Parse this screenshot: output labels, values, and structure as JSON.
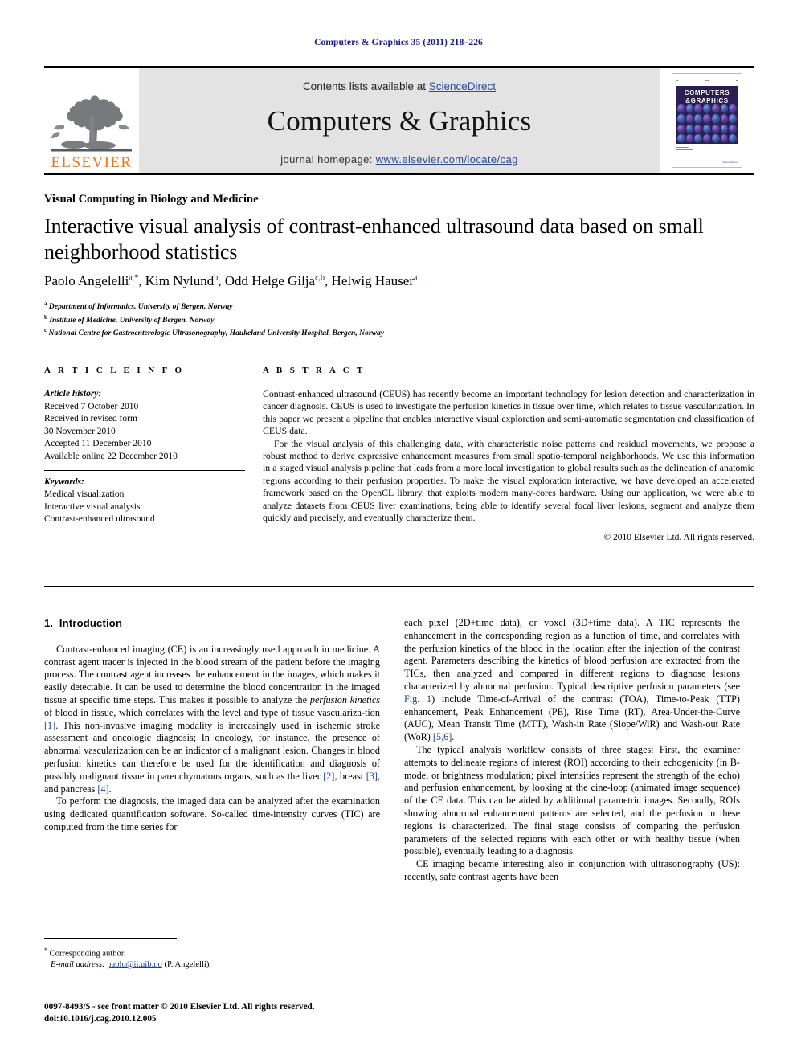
{
  "running_head": "Computers & Graphics 35 (2011) 218–226",
  "masthead": {
    "publisher_name": "ELSEVIER",
    "contents_prefix": "Contents lists available at ",
    "contents_link": "ScienceDirect",
    "journal_title": "Computers & Graphics",
    "homepage_label": "journal homepage: ",
    "homepage_url": "www.elsevier.com/locate/cag",
    "cover": {
      "title_line1": "COMPUTERS",
      "title_line2": "&GRAPHICS",
      "sciencedirect": "ScienceDirect"
    }
  },
  "section_marker": "Visual Computing in Biology and Medicine",
  "title": "Interactive visual analysis of contrast-enhanced ultrasound data based on small neighborhood statistics",
  "authors": [
    {
      "name": "Paolo Angelelli",
      "marks": "a,",
      "star": "*"
    },
    {
      "name": "Kim Nylund",
      "marks": "b",
      "star": ""
    },
    {
      "name": "Odd Helge Gilja",
      "marks": "c,b",
      "star": ""
    },
    {
      "name": "Helwig Hauser",
      "marks": "a",
      "star": ""
    }
  ],
  "affiliations": [
    {
      "mark": "a",
      "text": "Department of Informatics, University of Bergen, Norway"
    },
    {
      "mark": "b",
      "text": "Institute of Medicine, University of Bergen, Norway"
    },
    {
      "mark": "c",
      "text": "National Centre for Gastroenterologic Ultrasonography, Haukeland University Hospital, Bergen, Norway"
    }
  ],
  "article_info": {
    "heading": "A R T I C L E  I N F O",
    "history_label": "Article history:",
    "history": [
      "Received 7 October 2010",
      "Received in revised form",
      "30 November 2010",
      "Accepted 11 December 2010",
      "Available online 22 December 2010"
    ],
    "keywords_label": "Keywords:",
    "keywords": [
      "Medical visualization",
      "Interactive visual analysis",
      "Contrast-enhanced ultrasound"
    ]
  },
  "abstract": {
    "heading": "A B S T R A C T",
    "paragraphs": [
      "Contrast-enhanced ultrasound (CEUS) has recently become an important technology for lesion detection and characterization in cancer diagnosis. CEUS is used to investigate the perfusion kinetics in tissue over time, which relates to tissue vascularization. In this paper we present a pipeline that enables interactive visual exploration and semi-automatic segmentation and classification of CEUS data.",
      "For the visual analysis of this challenging data, with characteristic noise patterns and residual movements, we propose a robust method to derive expressive enhancement measures from small spatio-temporal neighborhoods. We use this information in a staged visual analysis pipeline that leads from a more local investigation to global results such as the delineation of anatomic regions according to their perfusion properties. To make the visual exploration interactive, we have developed an accelerated framework based on the OpenCL library, that exploits modern many-cores hardware. Using our application, we were able to analyze datasets from CEUS liver examinations, being able to identify several focal liver lesions, segment and analyze them quickly and precisely, and eventually characterize them."
    ],
    "copyright": "© 2010 Elsevier Ltd. All rights reserved."
  },
  "body": {
    "section_number": "1.",
    "section_title": "Introduction",
    "left_column": [
      {
        "indent": true,
        "runs": [
          {
            "t": "Contrast-enhanced imaging (CE) is an increasingly used approach in medicine. A contrast agent tracer is injected in the blood stream of the patient before the imaging process. The contrast agent increases the enhancement in the images, which makes it easily detectable. It can be used to determine the blood concentration in the imaged tissue at specific time steps. This makes it possible to analyze the "
          },
          {
            "t": "perfusion kinetics",
            "style": "em"
          },
          {
            "t": " of blood in tissue, which correlates with the level and type of tissue vasculariza-tion "
          },
          {
            "t": "[1]",
            "style": "ref"
          },
          {
            "t": ". This non-invasive imaging modality is increasingly used in ischemic stroke assessment and oncologic diagnosis; In oncology, for instance, the presence of abnormal vascularization can be an indicator of a malignant lesion. Changes in blood perfusion kinetics can therefore be used for the identification and diagnosis of possibly malignant tissue in parenchymatous organs, such as the liver "
          },
          {
            "t": "[2]",
            "style": "ref"
          },
          {
            "t": ", breast "
          },
          {
            "t": "[3]",
            "style": "ref"
          },
          {
            "t": ", and pancreas "
          },
          {
            "t": "[4]",
            "style": "ref"
          },
          {
            "t": "."
          }
        ]
      },
      {
        "indent": true,
        "runs": [
          {
            "t": "To perform the diagnosis, the imaged data can be analyzed after the examination using dedicated quantification software. So-called time-intensity curves (TIC) are computed from the time series for"
          }
        ]
      }
    ],
    "right_column": [
      {
        "indent": false,
        "runs": [
          {
            "t": "each pixel (2D+time data), or voxel (3D+time data). A TIC represents the enhancement in the corresponding region as a function of time, and correlates with the perfusion kinetics of the blood in the location after the injection of the contrast agent. Parameters describing the kinetics of blood perfusion are extracted from the TICs, then analyzed and compared in different regions to diagnose lesions characterized by abnormal perfusion. Typical descriptive perfusion parameters (see "
          },
          {
            "t": "Fig. 1",
            "style": "ref"
          },
          {
            "t": ") include Time-of-Arrival of the contrast (TOA), Time-to-Peak (TTP) enhancement, Peak Enhancement (PE), Rise Time (RT), Area-Under-the-Curve (AUC), Mean Transit Time (MTT), Wash-in Rate (Slope/WiR) and Wash-out Rate (WoR) "
          },
          {
            "t": "[5,6]",
            "style": "ref"
          },
          {
            "t": "."
          }
        ]
      },
      {
        "indent": true,
        "runs": [
          {
            "t": "The typical analysis workflow consists of three stages: First, the examiner attempts to delineate regions of interest (ROI) according to their echogenicity (in B-mode, or brightness modulation; pixel intensities represent the strength of the echo) and perfusion enhancement, by looking at the cine-loop (animated image sequence) of the CE data. This can be aided by additional parametric images. Secondly, ROIs showing abnormal enhancement patterns are selected, and the perfusion in these regions is characterized. The final stage consists of comparing the perfusion parameters of the selected regions with each other or with healthy tissue (when possible), eventually leading to a diagnosis."
          }
        ]
      },
      {
        "indent": true,
        "runs": [
          {
            "t": "CE imaging became interesting also in conjunction with ultrasonography (US): recently, safe contrast agents have been"
          }
        ]
      }
    ]
  },
  "footnote": {
    "star": "*",
    "corresponding": "Corresponding author.",
    "email_label": "E-mail address:",
    "email": "paolo@ii.uib.no",
    "email_suffix": "(P. Angelelli)."
  },
  "imprint": {
    "line1": "0097-8493/$ - see front matter © 2010 Elsevier Ltd. All rights reserved.",
    "line2": "doi:10.1016/j.cag.2010.12.005"
  },
  "colors": {
    "elsevier_orange": "#E87722",
    "link_blue": "#2b4b9b",
    "ref_blue": "#1a3e9b",
    "running_head_blue": "#1a1a8c",
    "masthead_gray": "#e3e3e3"
  }
}
